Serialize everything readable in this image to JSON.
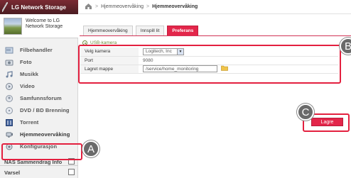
{
  "brand": {
    "name": "LG Network Storage"
  },
  "welcome": {
    "text": "Welcome to LG Network Storage"
  },
  "sidebar": {
    "items": [
      {
        "label": "Filbehandler",
        "icon": "file-manager-icon"
      },
      {
        "label": "Foto",
        "icon": "photo-icon"
      },
      {
        "label": "Musikk",
        "icon": "music-icon"
      },
      {
        "label": "Video",
        "icon": "video-icon"
      },
      {
        "label": "Samfunnsforum",
        "icon": "community-icon"
      },
      {
        "label": "DVD / BD Brenning",
        "icon": "disc-icon"
      },
      {
        "label": "Torrent",
        "icon": "torrent-icon"
      },
      {
        "label": "Hjemmeovervåking",
        "icon": "home-monitoring-icon"
      },
      {
        "label": "Konfigurasjon",
        "icon": "configuration-icon"
      }
    ],
    "bottom": [
      {
        "label": "NAS Sammendrag Info"
      },
      {
        "label": "Varsel"
      }
    ]
  },
  "breadcrumb": {
    "part1": "Hjemmeovervåking",
    "sep": ">",
    "part2": "Hjemmeovervåking"
  },
  "tabs": [
    {
      "label": "Hjemmeovervåking"
    },
    {
      "label": "Innspill lit"
    },
    {
      "label": "Preferans"
    }
  ],
  "section": {
    "label": "USB-kamera"
  },
  "form": {
    "rows": [
      {
        "label": "Velg kamera",
        "value": "Logitech, Inc"
      },
      {
        "label": "Port",
        "value": "9080"
      },
      {
        "label": "Lagret mappe",
        "value": "/service/home_monitoring"
      }
    ]
  },
  "save_button": {
    "label": "Lagre"
  },
  "callouts": {
    "a": "A",
    "b": "B",
    "c": "C"
  },
  "colors": {
    "accent": "#e3264a",
    "brand": "#5d2229",
    "callout": "#6a6a6a"
  }
}
